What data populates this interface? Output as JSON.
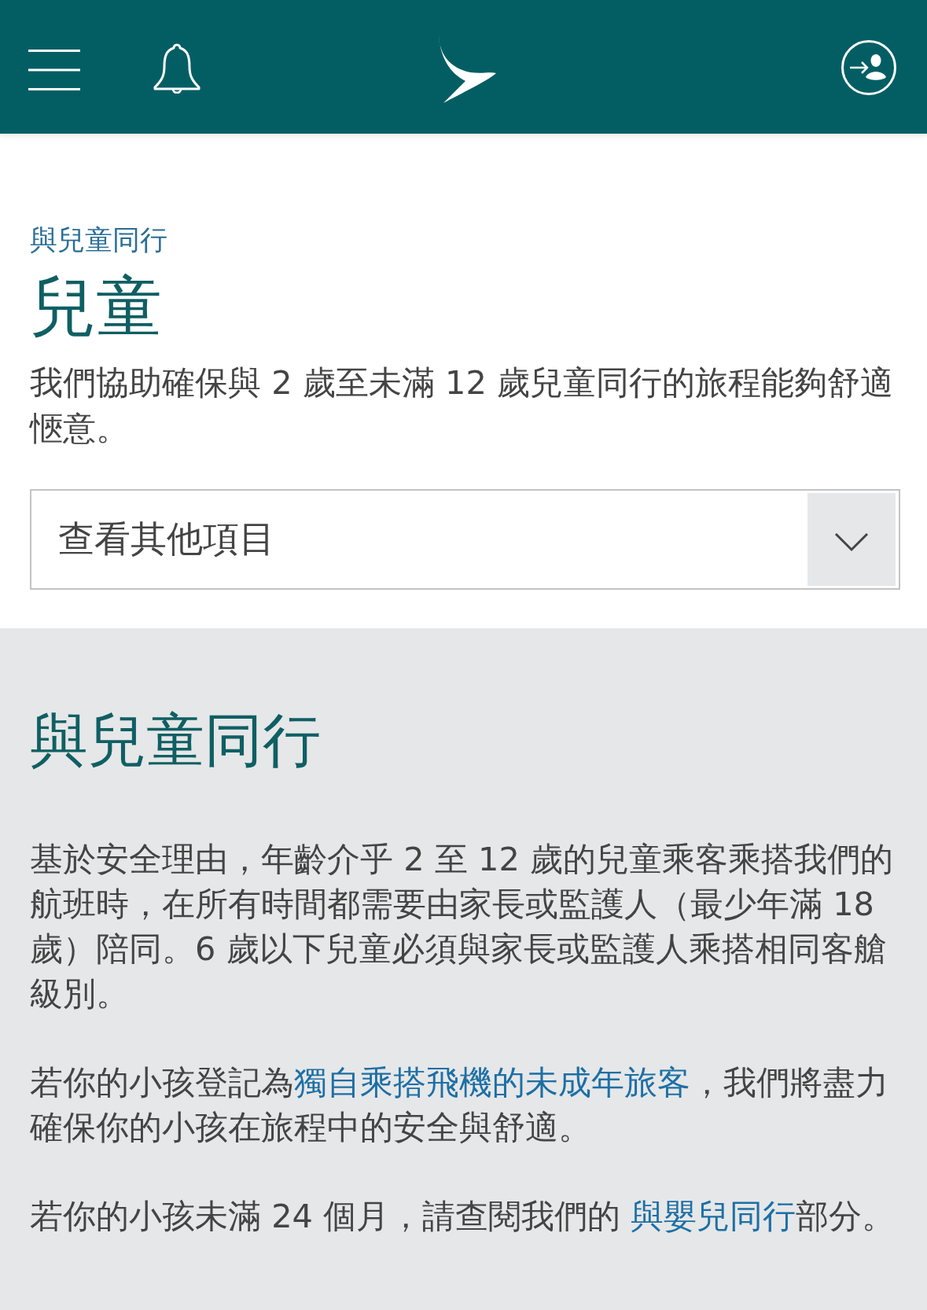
{
  "breadcrumb": "與兒童同行",
  "title": "兒童",
  "intro": "我們協助確保與 2 歲至未滿 12 歲兒童同行的旅程能夠舒適愜意。",
  "dropdown": {
    "label": "查看其他項目"
  },
  "section": {
    "heading": "與兒童同行",
    "paragraphs": [
      [
        {
          "kind": "text",
          "text": "基於安全理由，年齡介乎 2 至 12 歲的兒童乘客乘搭我們的航班時，在所有時間都需要由家長或監護人（最少年滿 18 歲）陪同。6 歲以下兒童必須與家長或監護人乘搭相同客艙級別。"
        }
      ],
      [
        {
          "kind": "text",
          "text": "若你的小孩登記為"
        },
        {
          "kind": "link",
          "text": "獨自乘搭飛機的未成年旅客"
        },
        {
          "kind": "text",
          "text": "，我們將盡力確保你的小孩在旅程中的安全與舒適。"
        }
      ],
      [
        {
          "kind": "text",
          "text": "若你的小孩未滿 24 個月，請查閱我們的 "
        },
        {
          "kind": "link",
          "text": "與嬰兒同行"
        },
        {
          "kind": "text",
          "text": "部分。"
        }
      ]
    ]
  }
}
